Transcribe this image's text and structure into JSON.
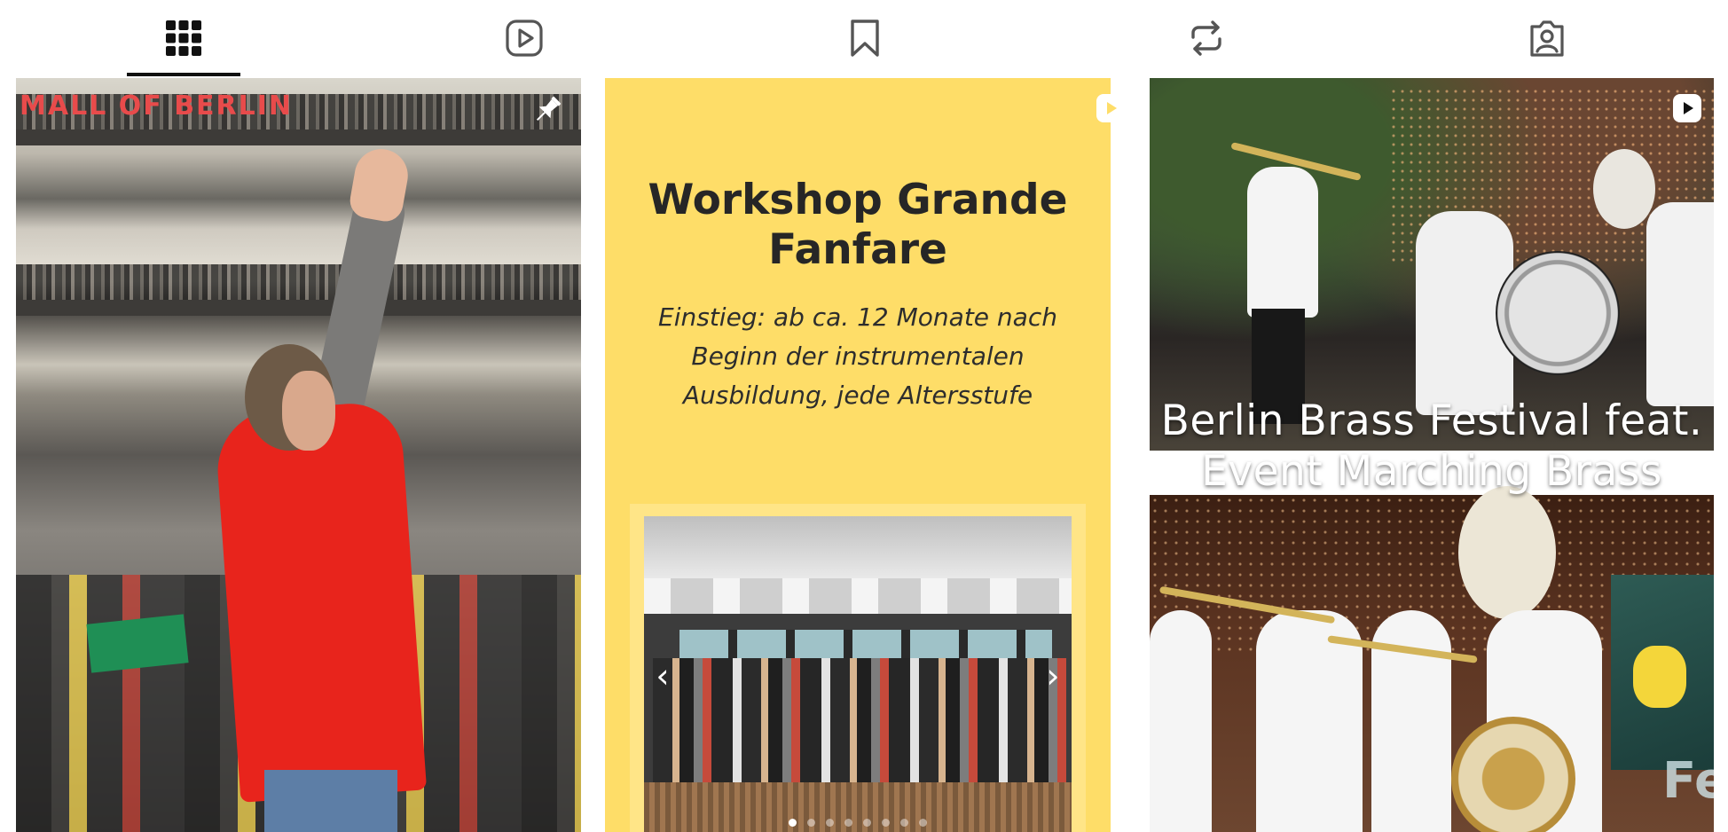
{
  "tabs": [
    {
      "icon": "grid-icon",
      "active": true
    },
    {
      "icon": "reels-icon",
      "active": false
    },
    {
      "icon": "saved-icon",
      "active": false
    },
    {
      "icon": "reposts-icon",
      "active": false
    },
    {
      "icon": "tagged-icon",
      "active": false
    }
  ],
  "posts": [
    {
      "type": "photo",
      "icon": "pin-icon",
      "image_description": "Conductor in red shirt raising his hand before a brass and flute band in a shopping mall",
      "overlay_text": {
        "sign_top": "MALL OF BERLIN"
      }
    },
    {
      "type": "carousel",
      "icon": "reel-icon",
      "background": "#fedd68",
      "title": "Workshop Grande Fanfare",
      "subtitle": "Einstieg: ab ca. 12 Monate nach Beginn der instrumentalen Ausbildung, jede Altersstufe",
      "carousel": {
        "prev_icon": "chevron-left-icon",
        "next_icon": "chevron-right-icon",
        "total_slides": 8,
        "active_slide": 1
      }
    },
    {
      "type": "reel",
      "icon": "reel-icon",
      "caption_line1": "Berlin Brass Festival feat.",
      "caption_line2": "Event Marching Brass"
    }
  ],
  "colors": {
    "active_tab_indicator": "#111111",
    "icon_gray": "#555555",
    "card_yellow": "#fedd68",
    "title_text": "#262626"
  }
}
